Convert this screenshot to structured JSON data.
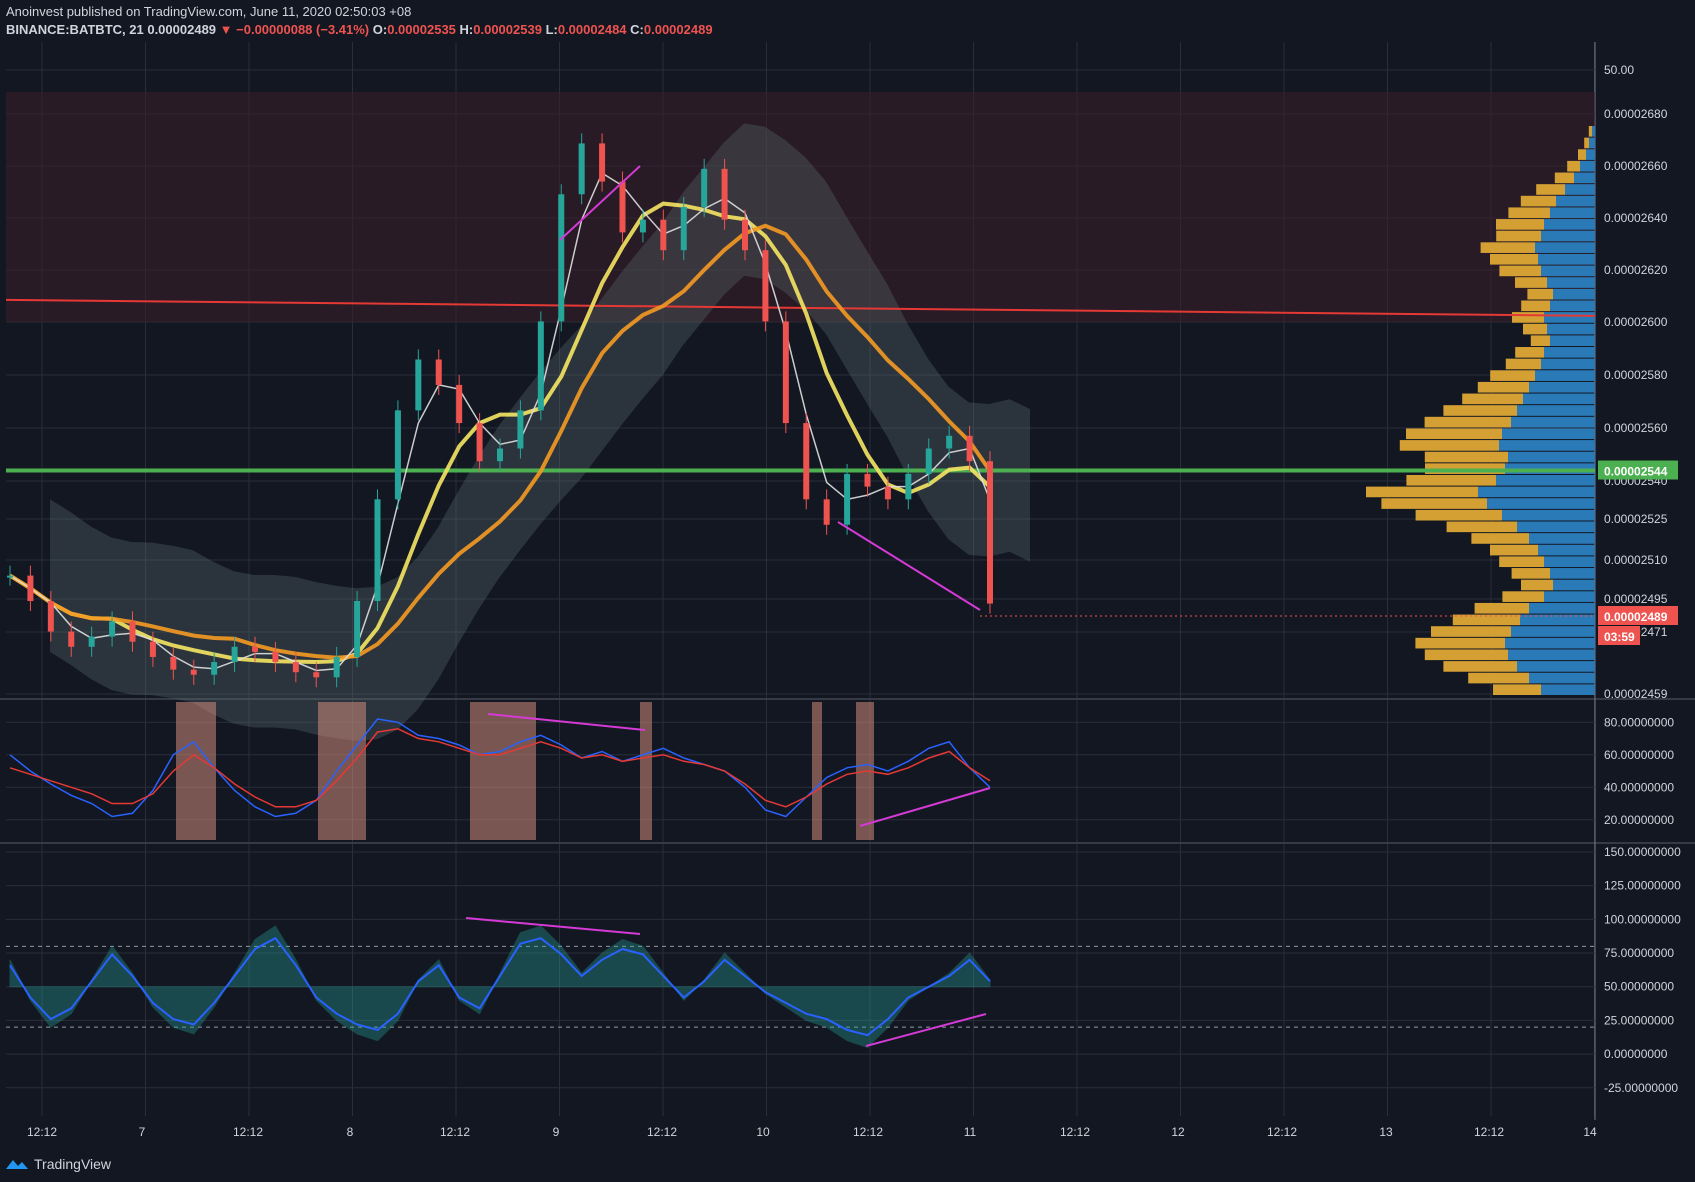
{
  "header": {
    "line1": "Anoinvest published on TradingView.com, June 11, 2020 02:50:03 +08",
    "symbol": "BINANCE:BATBTC, 21",
    "last": "0.00002489",
    "change": "▼ −0.00000088 (−3.41%)",
    "o_label": "O:",
    "o": "0.00002535",
    "h_label": "H:",
    "h": "0.00002539",
    "l_label": "L:",
    "l": "0.00002484",
    "c_label": "C:",
    "c": "0.00002489"
  },
  "footer": {
    "brand": "TradingView"
  },
  "colors": {
    "background": "#131722",
    "grid": "#2a2e39",
    "up": "#26a69a",
    "down": "#ef5350",
    "ma_yellow": "#f5e663",
    "ma_orange": "#f59a23",
    "support": "#4caf50",
    "resistance": "#e53935",
    "divergence": "#d63ad6",
    "vp_buy": "#d4a034",
    "vp_sell": "#2a7ab8"
  },
  "chart_data": [
    {
      "type": "candlestick",
      "panel": "price",
      "symbol": "BINANCE:BATBTC",
      "interval": "21",
      "y_ticks": [
        "50.00",
        "0.00002680",
        "0.00002660",
        "0.00002640",
        "0.00002620",
        "0.00002600",
        "0.00002580",
        "0.00002560",
        "0.00002540",
        "0.00002525",
        "0.00002510",
        "0.00002495",
        "0.00002471",
        "0.00002459"
      ],
      "price_labels": [
        {
          "value": "0.00002544",
          "color": "#4caf50"
        },
        {
          "value": "0.00002489",
          "color": "#ef5350"
        },
        {
          "value": "03:59",
          "color": "#ef5350"
        }
      ],
      "x_ticks": [
        "12:12",
        "7",
        "12:12",
        "8",
        "12:12",
        "9",
        "12:12",
        "10",
        "12:12",
        "11",
        "12:12",
        "12",
        "12:12",
        "13",
        "12:12",
        "14"
      ],
      "close_series": [
        2.5,
        2.49,
        2.478,
        2.472,
        2.476,
        2.482,
        2.474,
        2.468,
        2.463,
        2.461,
        2.466,
        2.472,
        2.47,
        2.466,
        2.462,
        2.46,
        2.468,
        2.49,
        2.53,
        2.565,
        2.585,
        2.575,
        2.56,
        2.545,
        2.55,
        2.565,
        2.6,
        2.65,
        2.67,
        2.655,
        2.635,
        2.64,
        2.628,
        2.645,
        2.66,
        2.64,
        2.628,
        2.6,
        2.56,
        2.53,
        2.52,
        2.54,
        2.535,
        2.53,
        2.54,
        2.55,
        2.555,
        2.545,
        2.489
      ],
      "horizontal_levels": [
        {
          "price": 2.544e-05,
          "style": "support"
        },
        {
          "price": 2.603e-05,
          "style": "resistance"
        }
      ],
      "volume_profile": {
        "buy": [
          2,
          3,
          5,
          8,
          12,
          18,
          22,
          26,
          30,
          28,
          34,
          30,
          26,
          20,
          16,
          18,
          20,
          15,
          12,
          18,
          22,
          28,
          32,
          38,
          46,
          54,
          60,
          62,
          52,
          50,
          56,
          70,
          66,
          54,
          44,
          36,
          30,
          28,
          24,
          20,
          26,
          34,
          42,
          50,
          56,
          52,
          46,
          38,
          30
        ],
        "sell": [
          2,
          4,
          6,
          10,
          14,
          20,
          26,
          30,
          34,
          36,
          40,
          38,
          36,
          32,
          28,
          30,
          34,
          32,
          30,
          34,
          36,
          40,
          44,
          48,
          52,
          56,
          62,
          64,
          58,
          60,
          66,
          78,
          72,
          62,
          52,
          44,
          38,
          34,
          30,
          28,
          34,
          44,
          50,
          56,
          60,
          58,
          52,
          44,
          36
        ]
      }
    },
    {
      "type": "line",
      "panel": "oscillator_1",
      "y_ticks": [
        "80.00000000",
        "60.00000000",
        "40.00000000",
        "20.00000000"
      ],
      "ylim": [
        10,
        90
      ],
      "series": [
        {
          "values": [
            60,
            50,
            42,
            35,
            30,
            22,
            24,
            38,
            60,
            68,
            52,
            38,
            28,
            22,
            24,
            32,
            50,
            66,
            82,
            80,
            72,
            70,
            66,
            60,
            62,
            68,
            72,
            66,
            58,
            62,
            56,
            60,
            64,
            58,
            54,
            50,
            40,
            26,
            22,
            34,
            46,
            52,
            54,
            50,
            56,
            64,
            68,
            52,
            40
          ]
        },
        {
          "values": [
            52,
            48,
            44,
            40,
            36,
            30,
            30,
            36,
            50,
            60,
            52,
            42,
            34,
            28,
            28,
            32,
            44,
            58,
            74,
            76,
            70,
            68,
            64,
            60,
            60,
            64,
            68,
            64,
            58,
            60,
            56,
            58,
            60,
            56,
            54,
            50,
            42,
            32,
            28,
            34,
            42,
            48,
            50,
            48,
            52,
            58,
            62,
            52,
            44
          ]
        }
      ]
    },
    {
      "type": "line",
      "panel": "oscillator_2",
      "y_ticks": [
        "150.00000000",
        "125.00000000",
        "100.00000000",
        "75.00000000",
        "50.00000000",
        "25.00000000",
        "0.00000000",
        "-25.00000000"
      ],
      "ylim": [
        -40,
        150
      ],
      "series": [
        {
          "values": [
            70,
            40,
            20,
            30,
            55,
            80,
            60,
            35,
            20,
            15,
            35,
            60,
            85,
            95,
            70,
            40,
            25,
            15,
            10,
            25,
            55,
            70,
            40,
            30,
            60,
            90,
            95,
            80,
            60,
            75,
            85,
            80,
            60,
            40,
            55,
            75,
            60,
            45,
            35,
            25,
            20,
            10,
            5,
            20,
            40,
            50,
            60,
            75,
            55
          ]
        }
      ]
    }
  ]
}
